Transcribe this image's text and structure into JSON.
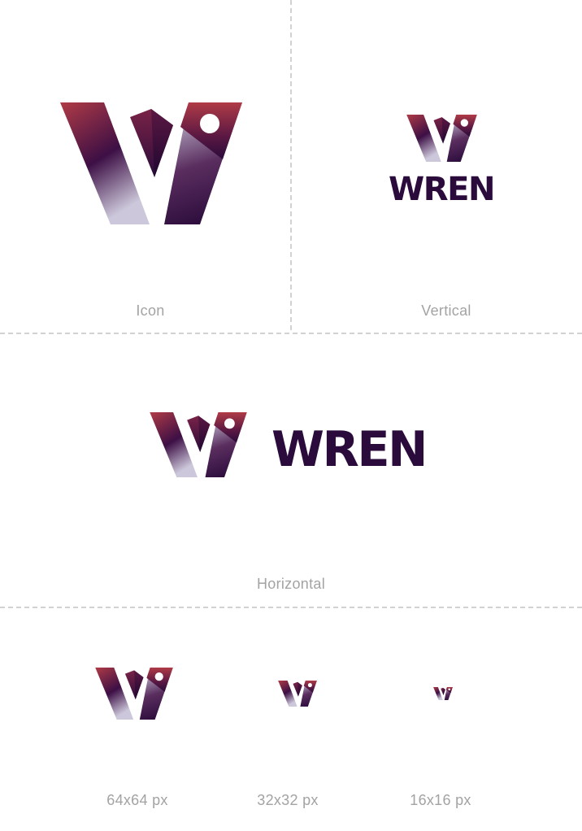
{
  "brand": {
    "wordmark": "WREN",
    "colors": {
      "gradient_top": "#b03b46",
      "gradient_mid": "#3d0f45",
      "gradient_light": "#c8c3d6",
      "wordmark": "#2a0b3b",
      "caption": "#a3a3a3",
      "divider": "#d2d2d2"
    }
  },
  "sections": {
    "icon": {
      "caption": "Icon"
    },
    "vertical": {
      "caption": "Vertical"
    },
    "horizontal": {
      "caption": "Horizontal"
    }
  },
  "sizes": [
    {
      "caption": "64x64 px"
    },
    {
      "caption": "32x32 px"
    },
    {
      "caption": "16x16 px"
    }
  ]
}
